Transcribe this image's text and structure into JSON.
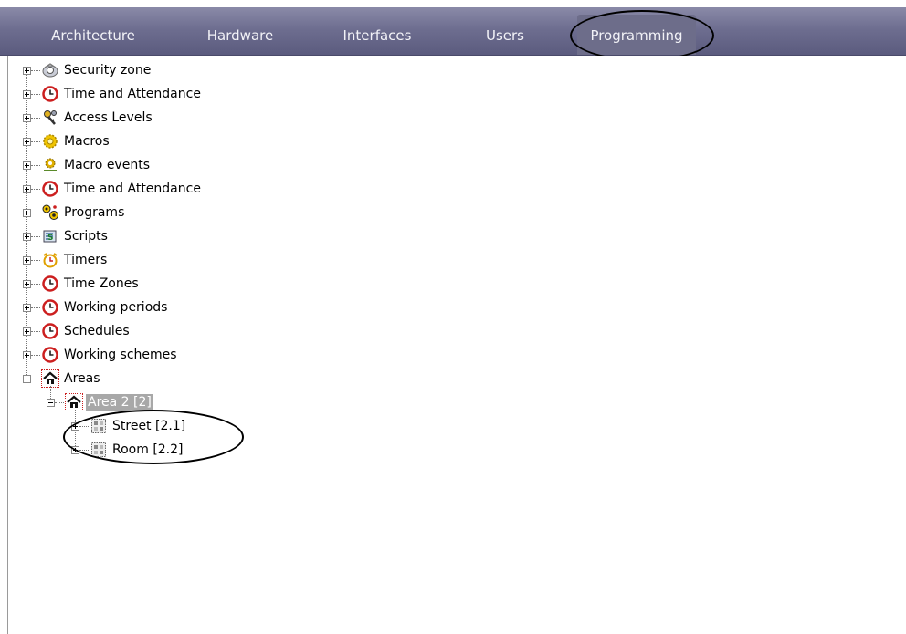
{
  "tabs": [
    {
      "label": "Architecture"
    },
    {
      "label": "Hardware"
    },
    {
      "label": "Interfaces"
    },
    {
      "label": "Users"
    },
    {
      "label": "Programming"
    }
  ],
  "active_tab": "Programming",
  "tree": {
    "items": [
      {
        "label": "Security zone",
        "icon": "security-zone-icon"
      },
      {
        "label": "Time and Attendance",
        "icon": "clock-icon"
      },
      {
        "label": "Access Levels",
        "icon": "keys-icon"
      },
      {
        "label": "Macros",
        "icon": "macro-gear-icon"
      },
      {
        "label": "Macro events",
        "icon": "macro-events-icon"
      },
      {
        "label": "Time and Attendance",
        "icon": "clock-icon"
      },
      {
        "label": "Programs",
        "icon": "programs-icon"
      },
      {
        "label": "Scripts",
        "icon": "script-icon"
      },
      {
        "label": "Timers",
        "icon": "alarm-clock-icon"
      },
      {
        "label": "Time Zones",
        "icon": "clock-icon"
      },
      {
        "label": "Working periods",
        "icon": "clock-icon"
      },
      {
        "label": "Schedules",
        "icon": "clock-icon"
      },
      {
        "label": "Working schemes",
        "icon": "clock-icon"
      },
      {
        "label": "Areas",
        "icon": "house-icon"
      }
    ],
    "area": {
      "label": "Area 2 [2]",
      "icon": "house-icon",
      "selected": true
    },
    "children": [
      {
        "label": "Street [2.1]",
        "icon": "zone-grid-icon"
      },
      {
        "label": "Room [2.2]",
        "icon": "zone-grid-icon"
      }
    ]
  },
  "colors": {
    "tabbar": "#6e6e90",
    "selection": "#a8a8a8",
    "clock_red": "#cc1f1f"
  }
}
